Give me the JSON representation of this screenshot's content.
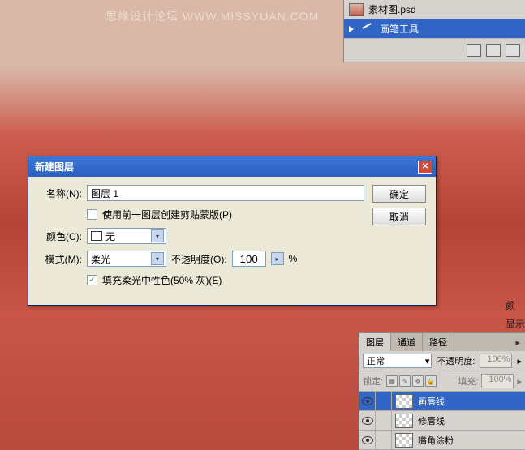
{
  "watermark": "思缘设计论坛  WWW.MISSYUAN.COM",
  "history": {
    "doc_name": "素材图.psd",
    "item": "画笔工具"
  },
  "dialog": {
    "title": "新建图层",
    "name_label": "名称(N):",
    "name_value": "图层 1",
    "clip_label": "使用前一图层创建剪贴蒙版(P)",
    "color_label": "颜色(C):",
    "color_value": "无",
    "mode_label": "模式(M):",
    "mode_value": "柔光",
    "opacity_label": "不透明度(O):",
    "opacity_value": "100",
    "opacity_unit": "%",
    "fill_label": "填充柔光中性色(50% 灰)(E)",
    "ok": "确定",
    "cancel": "取消"
  },
  "side": {
    "a": "颜",
    "b": "显示"
  },
  "layers": {
    "tab_layers": "图层",
    "tab_channels": "通道",
    "tab_paths": "路径",
    "blend_mode": "正常",
    "opacity_label": "不透明度:",
    "opacity_value": "100%",
    "lock_label": "锁定:",
    "fill_label": "填充:",
    "fill_value": "100%",
    "items": [
      {
        "name": "画唇线",
        "selected": true
      },
      {
        "name": "修唇线",
        "selected": false
      },
      {
        "name": "嘴角涂粉",
        "selected": false
      }
    ]
  }
}
